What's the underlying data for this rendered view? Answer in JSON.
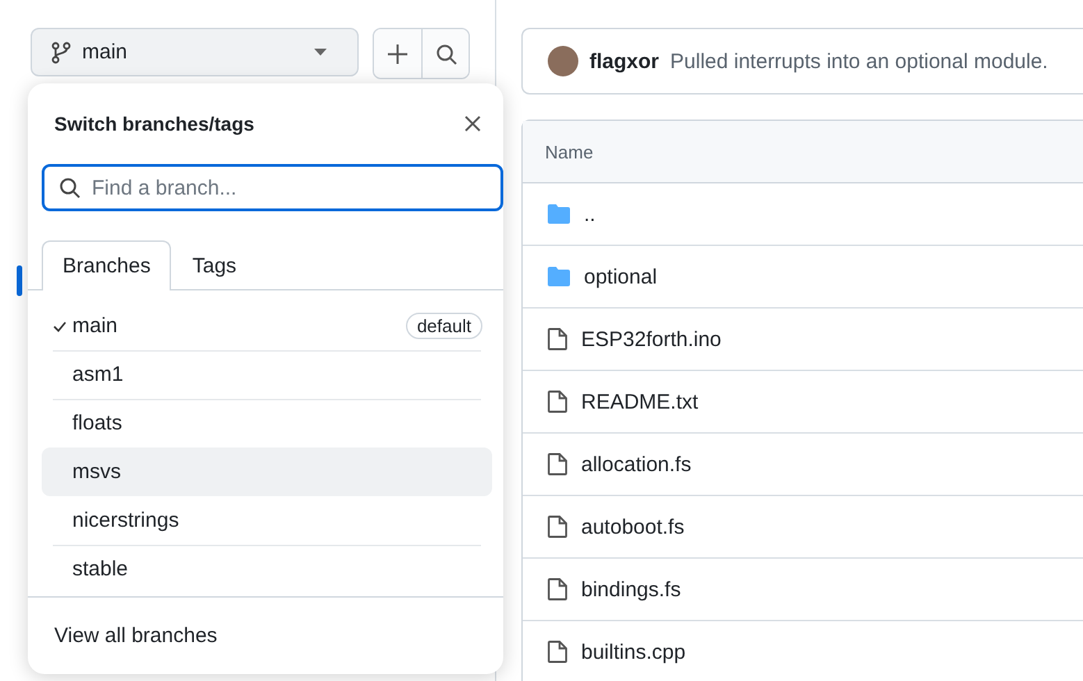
{
  "branch_selector": {
    "label": "main"
  },
  "dropdown": {
    "title": "Switch branches/tags",
    "search": {
      "placeholder": "Find a branch..."
    },
    "tabs": [
      {
        "label": "Branches",
        "selected": true
      },
      {
        "label": "Tags",
        "selected": false
      }
    ],
    "branches": [
      {
        "name": "main",
        "selected": true,
        "hovered": false,
        "badge": "default"
      },
      {
        "name": "asm1",
        "selected": false,
        "hovered": false
      },
      {
        "name": "floats",
        "selected": false,
        "hovered": false
      },
      {
        "name": "msvs",
        "selected": false,
        "hovered": true
      },
      {
        "name": "nicerstrings",
        "selected": false,
        "hovered": false
      },
      {
        "name": "stable",
        "selected": false,
        "hovered": false
      }
    ],
    "footer_link": "View all branches"
  },
  "commit": {
    "author": "flagxor",
    "message": "Pulled interrupts into an optional module."
  },
  "table": {
    "columns": [
      "Name"
    ],
    "rows": [
      {
        "name": "..",
        "kind": "folder"
      },
      {
        "name": "optional",
        "kind": "folder"
      },
      {
        "name": "ESP32forth.ino",
        "kind": "file"
      },
      {
        "name": "README.txt",
        "kind": "file"
      },
      {
        "name": "allocation.fs",
        "kind": "file"
      },
      {
        "name": "autoboot.fs",
        "kind": "file"
      },
      {
        "name": "bindings.fs",
        "kind": "file"
      },
      {
        "name": "builtins.cpp",
        "kind": "file"
      }
    ]
  }
}
